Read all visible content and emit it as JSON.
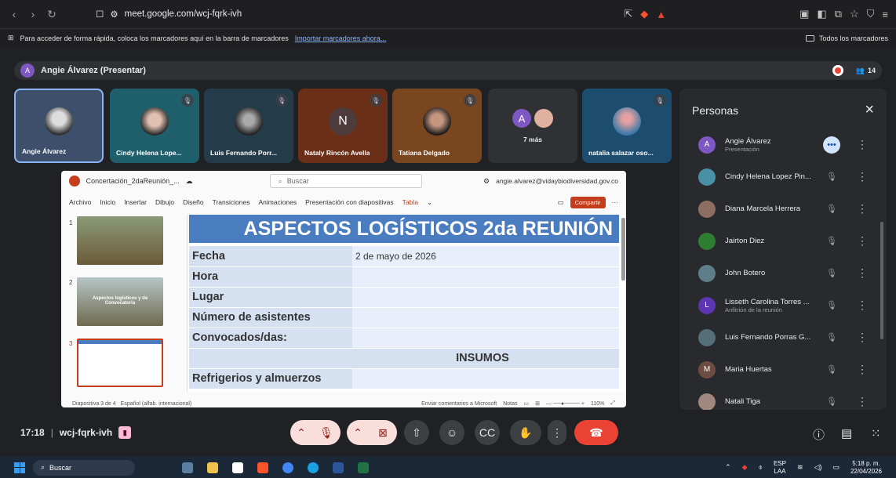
{
  "browser": {
    "url": "meet.google.com/wcj-fqrk-ivh",
    "bookmarks_hint": "Para acceder de forma rápida, coloca los marcadores aquí en la barra de marcadores",
    "import_link": "Importar marcadores ahora...",
    "all_bookmarks": "Todos los marcadores"
  },
  "meet_header": {
    "avatar_letter": "A",
    "presenter_label": "Angie Álvarez (Presentar)",
    "participant_count": "14"
  },
  "tiles": [
    {
      "name": "Angie Álvarez"
    },
    {
      "name": "Cindy Helena Lope..."
    },
    {
      "name": "Luis Fernando Porr..."
    },
    {
      "name": "Nataly Rincón Avella",
      "initial": "N"
    },
    {
      "name": "Tatiana Delgado"
    },
    {
      "more": "7 más",
      "initial": "A"
    },
    {
      "name": "natalia salazar oso..."
    }
  ],
  "ppt": {
    "filename": "Concertación_2daReunión_...",
    "search_placeholder": "Buscar",
    "account": "angie.alvarez@vidaybiodiversidad.gov.co",
    "menu": [
      "Archivo",
      "Inicio",
      "Insertar",
      "Dibujo",
      "Diseño",
      "Transiciones",
      "Animaciones",
      "Presentación con diapositivas"
    ],
    "menu_tabla": "Tabla",
    "share_label": "Compartir",
    "thumbs": [
      {
        "num": "1"
      },
      {
        "num": "2",
        "caption": "Aspectos logísticos y de Convocatoria"
      },
      {
        "num": "3"
      }
    ],
    "slide": {
      "title": "ASPECTOS LOGÍSTICOS 2da REUNIÓN",
      "rows": [
        {
          "label": "Fecha",
          "value": "2 de mayo de 2026"
        },
        {
          "label": "Hora",
          "value": ""
        },
        {
          "label": "Lugar",
          "value": ""
        },
        {
          "label": "Número de asistentes",
          "value": ""
        },
        {
          "label": "Convocados/das:",
          "value": ""
        }
      ],
      "insumos": "INSUMOS",
      "refrigerios": "Refrigerios y almuerzos"
    },
    "status": {
      "slide_count": "Diapositiva 3 de 4",
      "language": "Español (alfab. internacional)",
      "feedback": "Enviar comentarios a Microsoft",
      "notes": "Notas",
      "zoom": "110%"
    }
  },
  "panel": {
    "title": "Personas",
    "people": [
      {
        "name": "Angie Álvarez",
        "role": "Presentación",
        "initial": "A",
        "color": "#7e57c2"
      },
      {
        "name": "Cindy Helena Lopez Pin...",
        "color": "#4a90a4"
      },
      {
        "name": "Diana Marcela Herrera",
        "color": "#8d6e63"
      },
      {
        "name": "Jairton Diez",
        "color": "#2e7d32"
      },
      {
        "name": "John Botero",
        "color": "#607d8b"
      },
      {
        "name": "Lisseth Carolina Torres ...",
        "role": "Anfitrión de la reunión",
        "initial": "L",
        "color": "#5e35b1"
      },
      {
        "name": "Luis Fernando Porras G...",
        "color": "#546e7a"
      },
      {
        "name": "Maria Huertas",
        "initial": "M",
        "color": "#6d4c41"
      },
      {
        "name": "Natali Tiga",
        "color": "#a1887f"
      }
    ]
  },
  "controls": {
    "time": "17:18",
    "meeting_code": "wcj-fqrk-ivh"
  },
  "taskbar": {
    "search": "Buscar",
    "lang_top": "ESP",
    "lang_bottom": "LAA",
    "time": "5:18 p. m.",
    "date": "22/04/2026"
  }
}
